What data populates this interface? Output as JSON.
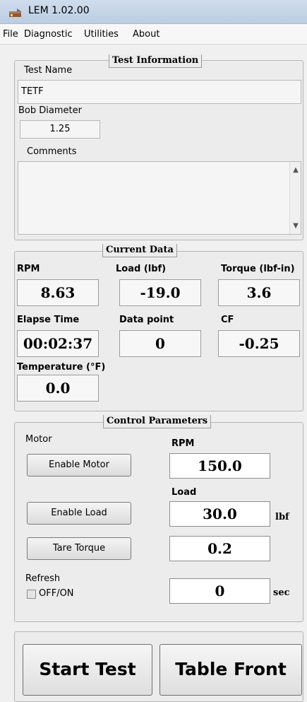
{
  "window": {
    "title": "LEM 1.02.00"
  },
  "menu": {
    "items": [
      "File",
      "Diagnostic",
      "Utilities",
      "About"
    ]
  },
  "test_info": {
    "title": "Test Information",
    "test_name_label": "Test Name",
    "test_name_value": "TETF",
    "bob_diameter_label": "Bob Diameter",
    "bob_diameter_value": "1.25",
    "comments_label": "Comments",
    "comments_value": ""
  },
  "current_data": {
    "title": "Current Data",
    "rpm_label": "RPM",
    "rpm_value": "8.63",
    "load_label": "Load (lbf)",
    "load_value": "-19.0",
    "torque_label": "Torque (lbf-in)",
    "torque_value": "3.6",
    "elapse_label": "Elapse Time",
    "elapse_value": "00:02:37",
    "datapoint_label": "Data point",
    "datapoint_value": "0",
    "cf_label": "CF",
    "cf_value": "-0.25",
    "temp_label": "Temperature (°F)",
    "temp_value": "0.0"
  },
  "control": {
    "title": "Control Parameters",
    "motor_label": "Motor",
    "enable_motor_btn": "Enable Motor",
    "rpm_label": "RPM",
    "rpm_value": "150.0",
    "load_label": "Load",
    "enable_load_btn": "Enable Load",
    "load_value": "30.0",
    "load_unit": "lbf",
    "tare_btn": "Tare Torque",
    "tare_value": "0.2",
    "refresh_label": "Refresh",
    "refresh_toggle_label": "OFF/ON",
    "refresh_value": "0",
    "refresh_unit": "sec"
  },
  "actions": {
    "start_test": "Start Test",
    "table_front": "Table Front"
  }
}
